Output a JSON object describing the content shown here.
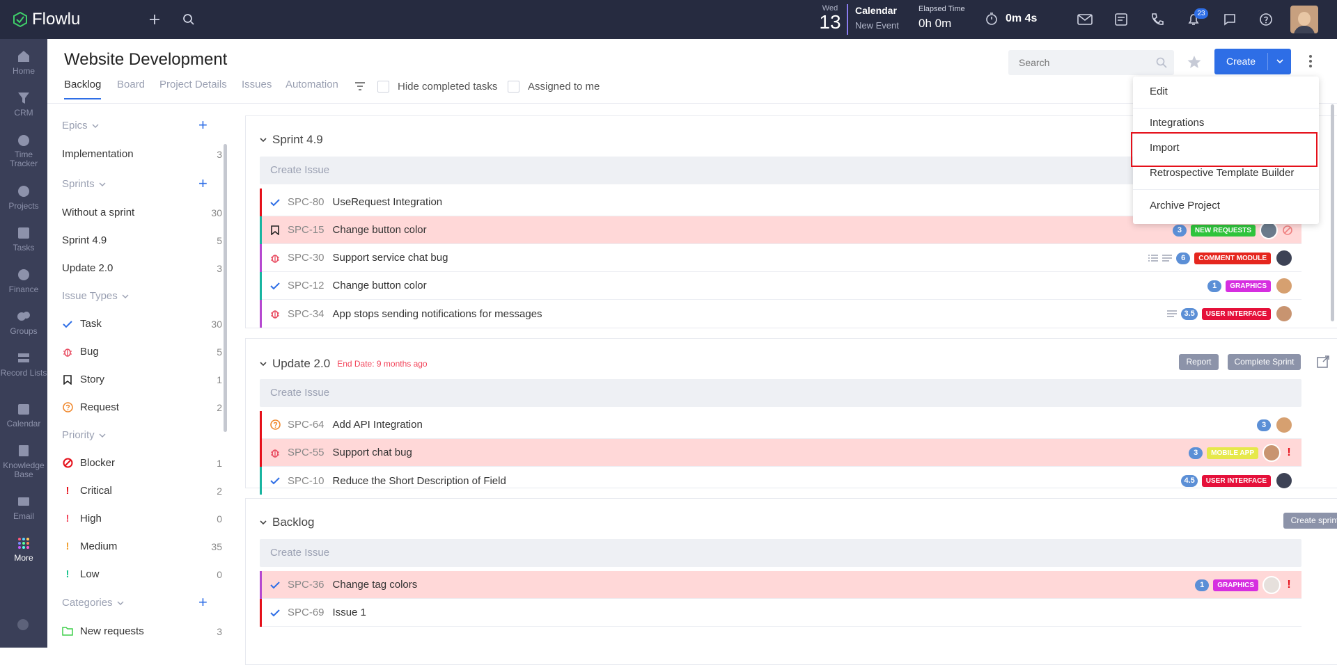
{
  "topbar": {
    "app_name": "Flowlu",
    "day": "Wed",
    "date": "13",
    "calendar_label": "Calendar",
    "new_event": "New Event",
    "elapsed_label": "Elapsed Time",
    "elapsed_value": "0h 0m",
    "timer_value": "0m 4s",
    "notifications": "23"
  },
  "nav": [
    {
      "label": "Home"
    },
    {
      "label": "CRM"
    },
    {
      "label": "Time Tracker"
    },
    {
      "label": "Projects"
    },
    {
      "label": "Tasks"
    },
    {
      "label": "Finance"
    },
    {
      "label": "Groups"
    },
    {
      "label": "Record Lists"
    },
    {
      "label": "Calendar"
    },
    {
      "label": "Knowledge Base"
    },
    {
      "label": "Email"
    },
    {
      "label": "More"
    }
  ],
  "header": {
    "title": "Website Development",
    "tabs": [
      "Backlog",
      "Board",
      "Project Details",
      "Issues",
      "Automation"
    ],
    "hide_completed": "Hide completed tasks",
    "assigned": "Assigned to me",
    "search_placeholder": "Search",
    "create": "Create"
  },
  "sidebar": {
    "epics": "Epics",
    "epic_items": [
      {
        "label": "Implementation",
        "count": "3"
      }
    ],
    "sprints": "Sprints",
    "sprint_items": [
      {
        "label": "Without a sprint",
        "count": "30"
      },
      {
        "label": "Sprint 4.9",
        "count": "5"
      },
      {
        "label": "Update 2.0",
        "count": "3"
      }
    ],
    "issue_types": "Issue Types",
    "type_items": [
      {
        "label": "Task",
        "count": "30"
      },
      {
        "label": "Bug",
        "count": "5"
      },
      {
        "label": "Story",
        "count": "1"
      },
      {
        "label": "Request",
        "count": "2"
      }
    ],
    "priority": "Priority",
    "priority_items": [
      {
        "label": "Blocker",
        "count": "1"
      },
      {
        "label": "Critical",
        "count": "2"
      },
      {
        "label": "High",
        "count": "0"
      },
      {
        "label": "Medium",
        "count": "35"
      },
      {
        "label": "Low",
        "count": "0"
      }
    ],
    "categories": "Categories",
    "category_items": [
      {
        "label": "New requests",
        "count": "3"
      }
    ]
  },
  "create_issue": "Create Issue",
  "sprint1": {
    "title": "Sprint 4.9",
    "rows": [
      {
        "key": "SPC-80",
        "title": "UseRequest Integration"
      },
      {
        "key": "SPC-15",
        "title": "Change button color",
        "num": "3",
        "tag": "NEW REQUESTS"
      },
      {
        "key": "SPC-30",
        "title": "Support service chat bug",
        "num": "6",
        "tag": "COMMENT MODULE"
      },
      {
        "key": "SPC-12",
        "title": "Change button color",
        "num": "1",
        "tag": "GRAPHICS"
      },
      {
        "key": "SPC-34",
        "title": "App stops sending notifications for messages",
        "num": "3.5",
        "tag": "USER INTERFACE"
      }
    ]
  },
  "sprint2": {
    "title": "Update 2.0",
    "end_date": "End Date: 9 months ago",
    "report": "Report",
    "complete": "Complete Sprint",
    "rows": [
      {
        "key": "SPC-64",
        "title": "Add API Integration",
        "num": "3"
      },
      {
        "key": "SPC-55",
        "title": "Support chat bug",
        "num": "3",
        "tag": "MOBILE APP"
      },
      {
        "key": "SPC-10",
        "title": "Reduce the Short Description of Field",
        "num": "4.5",
        "tag": "USER INTERFACE"
      }
    ]
  },
  "backlog": {
    "title": "Backlog",
    "create_sprint": "Create sprint",
    "rows": [
      {
        "key": "SPC-36",
        "title": "Change tag colors",
        "num": "1",
        "tag": "GRAPHICS"
      },
      {
        "key": "SPC-69",
        "title": "Issue 1"
      }
    ]
  },
  "menu": {
    "items": [
      "Edit",
      "Integrations",
      "Import",
      "Retrospective Template Builder",
      "Archive Project"
    ]
  },
  "colors": {
    "accent": "#2e6ee6",
    "highlight": "#e5101a",
    "pink": "#ffd8d8"
  }
}
